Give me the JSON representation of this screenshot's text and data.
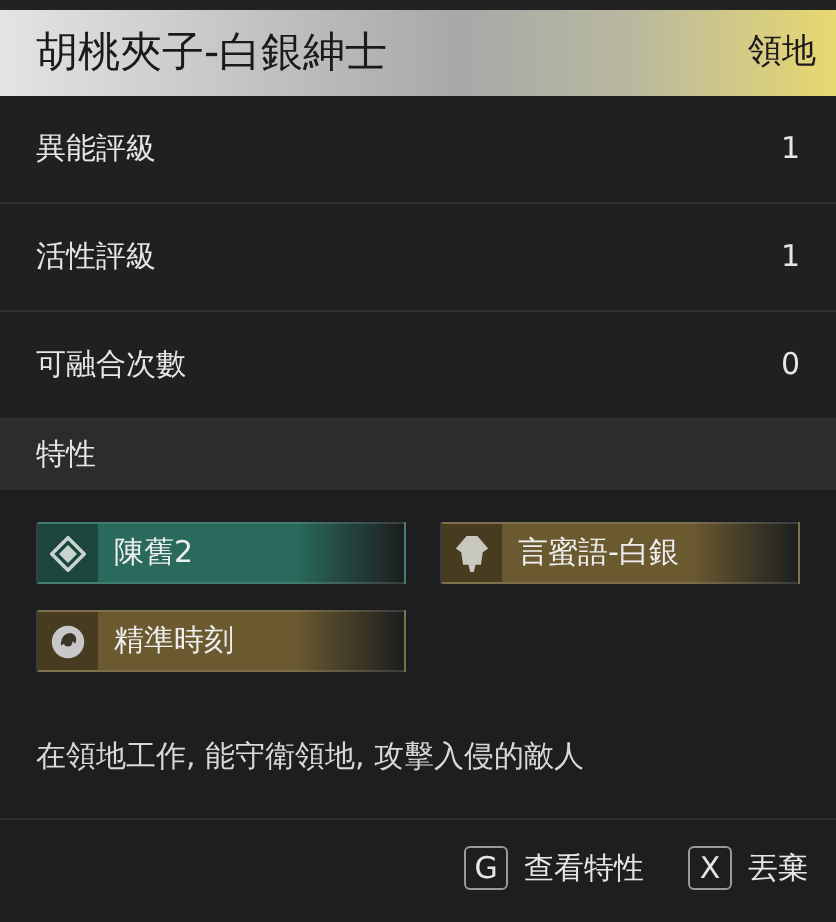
{
  "header": {
    "title": "胡桃夾子-白銀紳士",
    "tag": "領地"
  },
  "stats": [
    {
      "label": "異能評級",
      "value": "1"
    },
    {
      "label": "活性評級",
      "value": "1"
    },
    {
      "label": "可融合次數",
      "value": "0"
    }
  ],
  "traits_section": {
    "title": "特性",
    "traits": [
      {
        "name": "陳舊2",
        "color": "#2a6a5c"
      },
      {
        "name": "言蜜語-白銀",
        "color": "#6b5a30"
      },
      {
        "name": "精準時刻",
        "color": "#6b5a30"
      }
    ]
  },
  "description": "在領地工作, 能守衛領地, 攻擊入侵的敵人",
  "actions": [
    {
      "key": "G",
      "label": "查看特性"
    },
    {
      "key": "X",
      "label": "丟棄"
    }
  ]
}
